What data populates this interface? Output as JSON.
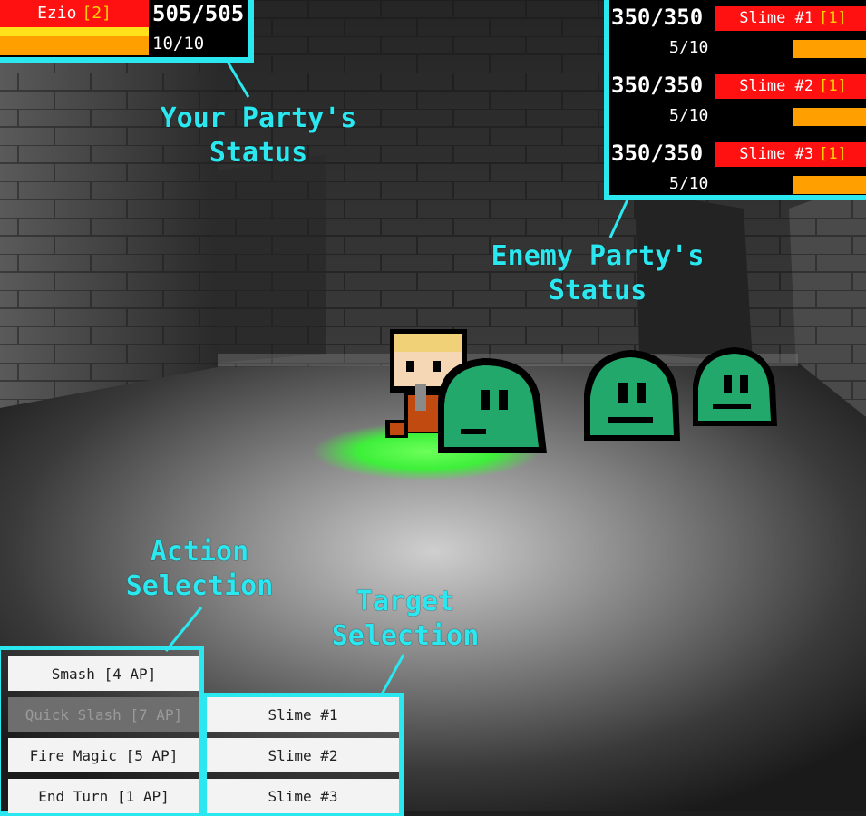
{
  "party": {
    "members": [
      {
        "name": "Ezio",
        "level": "[2]",
        "hp": "505/505",
        "ap": "10/10"
      }
    ]
  },
  "enemies": [
    {
      "name": "Slime #1",
      "level": "[1]",
      "hp": "350/350",
      "ap": "5/10"
    },
    {
      "name": "Slime #2",
      "level": "[1]",
      "hp": "350/350",
      "ap": "5/10"
    },
    {
      "name": "Slime #3",
      "level": "[1]",
      "hp": "350/350",
      "ap": "5/10"
    }
  ],
  "annotations": {
    "party_status": "Your Party's\nStatus",
    "enemy_status": "Enemy Party's\nStatus",
    "action_selection": "Action\nSelection",
    "target_selection": "Target\nSelection"
  },
  "actions": [
    {
      "label": "Smash [4 AP]",
      "enabled": true
    },
    {
      "label": "Quick Slash [7 AP]",
      "enabled": false
    },
    {
      "label": "Fire Magic [5 AP]",
      "enabled": true
    },
    {
      "label": "End Turn [1 AP]",
      "enabled": true
    }
  ],
  "targets": [
    {
      "label": "Slime #1"
    },
    {
      "label": "Slime #2"
    },
    {
      "label": "Slime #3"
    }
  ],
  "colors": {
    "accent": "#2be7ef",
    "name_bar": "#ff1111",
    "level_text": "#ffd100",
    "hp_bar": "#ffe21a",
    "ap_bar": "#ff9f00",
    "slime": "#22a86a",
    "highlight": "#3aff4e"
  }
}
